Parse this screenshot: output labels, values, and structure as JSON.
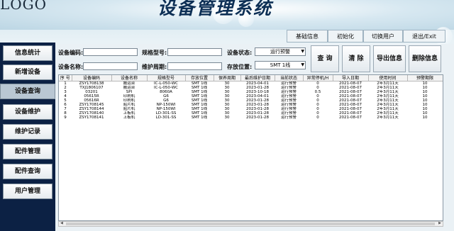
{
  "header": {
    "logo": "LOGO",
    "title": "设备管理系统"
  },
  "topbar": {
    "buttons": [
      "基础信息",
      "初始化",
      "切换用户",
      "退出/Exit"
    ]
  },
  "sidebar": {
    "items": [
      {
        "label": "信息统计",
        "active": false
      },
      {
        "label": "新增设备",
        "active": false
      },
      {
        "label": "设备查询",
        "active": true
      },
      {
        "label": "设备维护",
        "active": false
      },
      {
        "label": "维护记录",
        "active": false
      },
      {
        "label": "配件管理",
        "active": false
      },
      {
        "label": "配件查询",
        "active": false
      },
      {
        "label": "用户管理",
        "active": false
      }
    ]
  },
  "filters": {
    "code_label": "设备编码:",
    "code_value": "",
    "spec_label": "规格型号:",
    "spec_value": "",
    "status_label": "设备状态:",
    "status_value": "运行预警",
    "name_label": "设备名称:",
    "name_value": "",
    "period_label": "维护周期:",
    "period_value": "",
    "location_label": "存放位置:",
    "location_value": "SMT 1线"
  },
  "actions": {
    "query": "查 询",
    "clear": "清 除",
    "export": "导出信息",
    "delete": "删除信息"
  },
  "table": {
    "columns": [
      "序 号",
      "设备编码",
      "设备名称",
      "规格型号",
      "存放位置",
      "保养周期",
      "最后维护日期",
      "当前状态",
      "异常停机/H",
      "导入日期",
      "使用时间",
      "预警期限"
    ],
    "rows": [
      [
        "1",
        "ZSY1708138",
        "搬运台",
        "IC-L-050-WC",
        "SMT 1线",
        "30",
        "2023-04-01",
        "运行预警",
        "0",
        "2021-08-07",
        "2年3月11天",
        "10"
      ],
      [
        "2",
        "TXJ1806107",
        "搬运台",
        "IC-L-050-WC",
        "SMT 1线",
        "30",
        "2023-01-28",
        "运行预警",
        "0",
        "2021-08-07",
        "2年3月11天",
        "10"
      ],
      [
        "3",
        "03201",
        "SPI",
        "8060A",
        "SMT 1线",
        "30",
        "2023-10-18",
        "运行预警",
        "0.5",
        "2021-08-07",
        "2年3月11天",
        "10"
      ],
      [
        "4",
        "05615R",
        "印刷机",
        "G6",
        "SMT 1线",
        "30",
        "2023-04-01",
        "运行预警",
        "0",
        "2021-08-07",
        "2年3月11天",
        "10"
      ],
      [
        "5",
        "05616R",
        "印刷机",
        "G6",
        "SMT 1线",
        "30",
        "2023-01-28",
        "运行预警",
        "0",
        "2021-08-07",
        "2年3月11天",
        "10"
      ],
      [
        "6",
        "ZSY1708145",
        "贴片机",
        "NP-150WI",
        "SMT 1线",
        "30",
        "2023-01-28",
        "运行预警",
        "0",
        "2021-08-07",
        "2年3月11天",
        "10"
      ],
      [
        "7",
        "ZSY1708144",
        "贴片机",
        "NP-150WI",
        "SMT 1线",
        "30",
        "2023-01-28",
        "运行预警",
        "0",
        "2021-08-07",
        "2年3月11天",
        "10"
      ],
      [
        "8",
        "ZSY1708140",
        "上板机",
        "LD-301-SS",
        "SMT 1线",
        "30",
        "2023-01-28",
        "运行预警",
        "0",
        "2021-08-07",
        "2年3月11天",
        "10"
      ],
      [
        "9",
        "ZSY1708141",
        "上板机",
        "LD-301-SS",
        "SMT 1线",
        "30",
        "2023-01-28",
        "运行预警",
        "0",
        "2021-08-07",
        "2年3月11天",
        "10"
      ]
    ]
  },
  "colors": {
    "sidebar_bg": "#0c2144",
    "title": "#0d2f55"
  }
}
